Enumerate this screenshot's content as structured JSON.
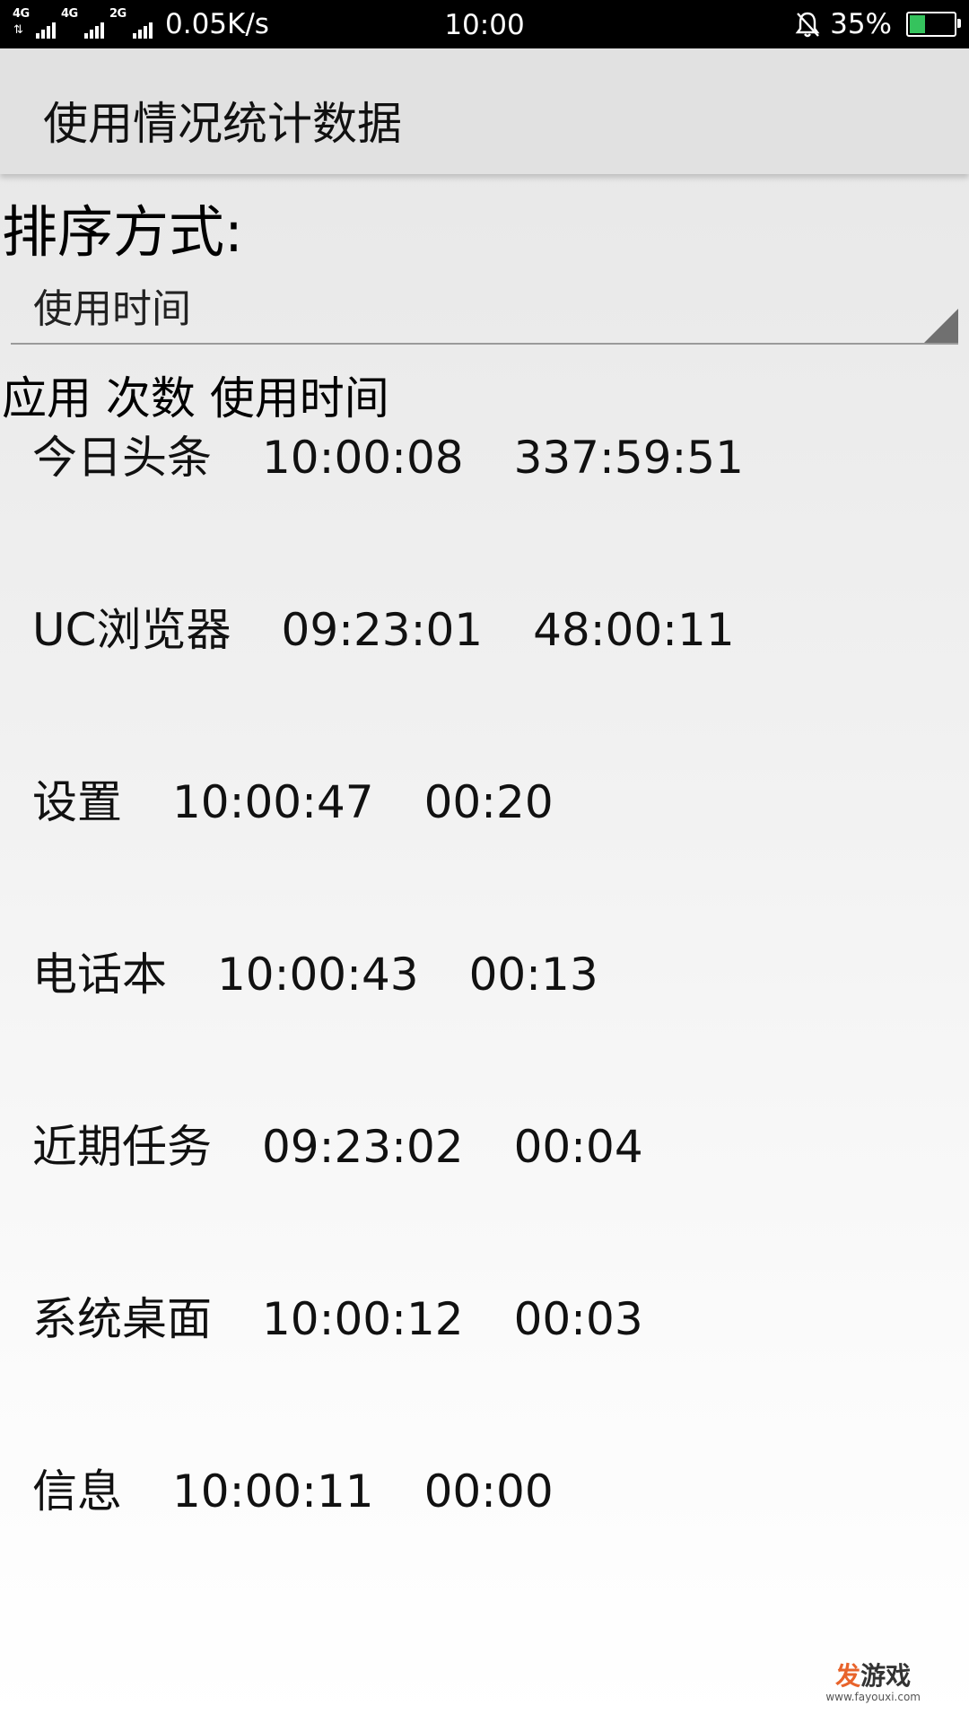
{
  "status_bar": {
    "network_1": "4G",
    "network_2": "4G",
    "network_3": "2G",
    "speed": "0.05K/s",
    "time": "10:00",
    "battery": "35%",
    "battery_level": 0.35,
    "battery_color": "#35c35d"
  },
  "action_bar": {
    "title": "使用情况统计数据"
  },
  "sort": {
    "label": "排序方式:",
    "selected": "使用时间"
  },
  "table": {
    "headers": [
      "应用",
      "次数",
      "使用时间"
    ],
    "rows": [
      {
        "app": "今日头条",
        "count": "10:00:08",
        "time": "337:59:51"
      },
      {
        "app": "UC浏览器",
        "count": "09:23:01",
        "time": "48:00:11"
      },
      {
        "app": "设置",
        "count": "10:00:47",
        "time": "00:20"
      },
      {
        "app": "电话本",
        "count": "10:00:43",
        "time": "00:13"
      },
      {
        "app": "近期任务",
        "count": "09:23:02",
        "time": "00:04"
      },
      {
        "app": "系统桌面",
        "count": "10:00:12",
        "time": "00:03"
      },
      {
        "app": "信息",
        "count": "10:00:11",
        "time": "00:00"
      }
    ]
  },
  "watermark": {
    "logo_part1": "发",
    "logo_part2": "游戏",
    "url": "www.fayouxi.com"
  }
}
